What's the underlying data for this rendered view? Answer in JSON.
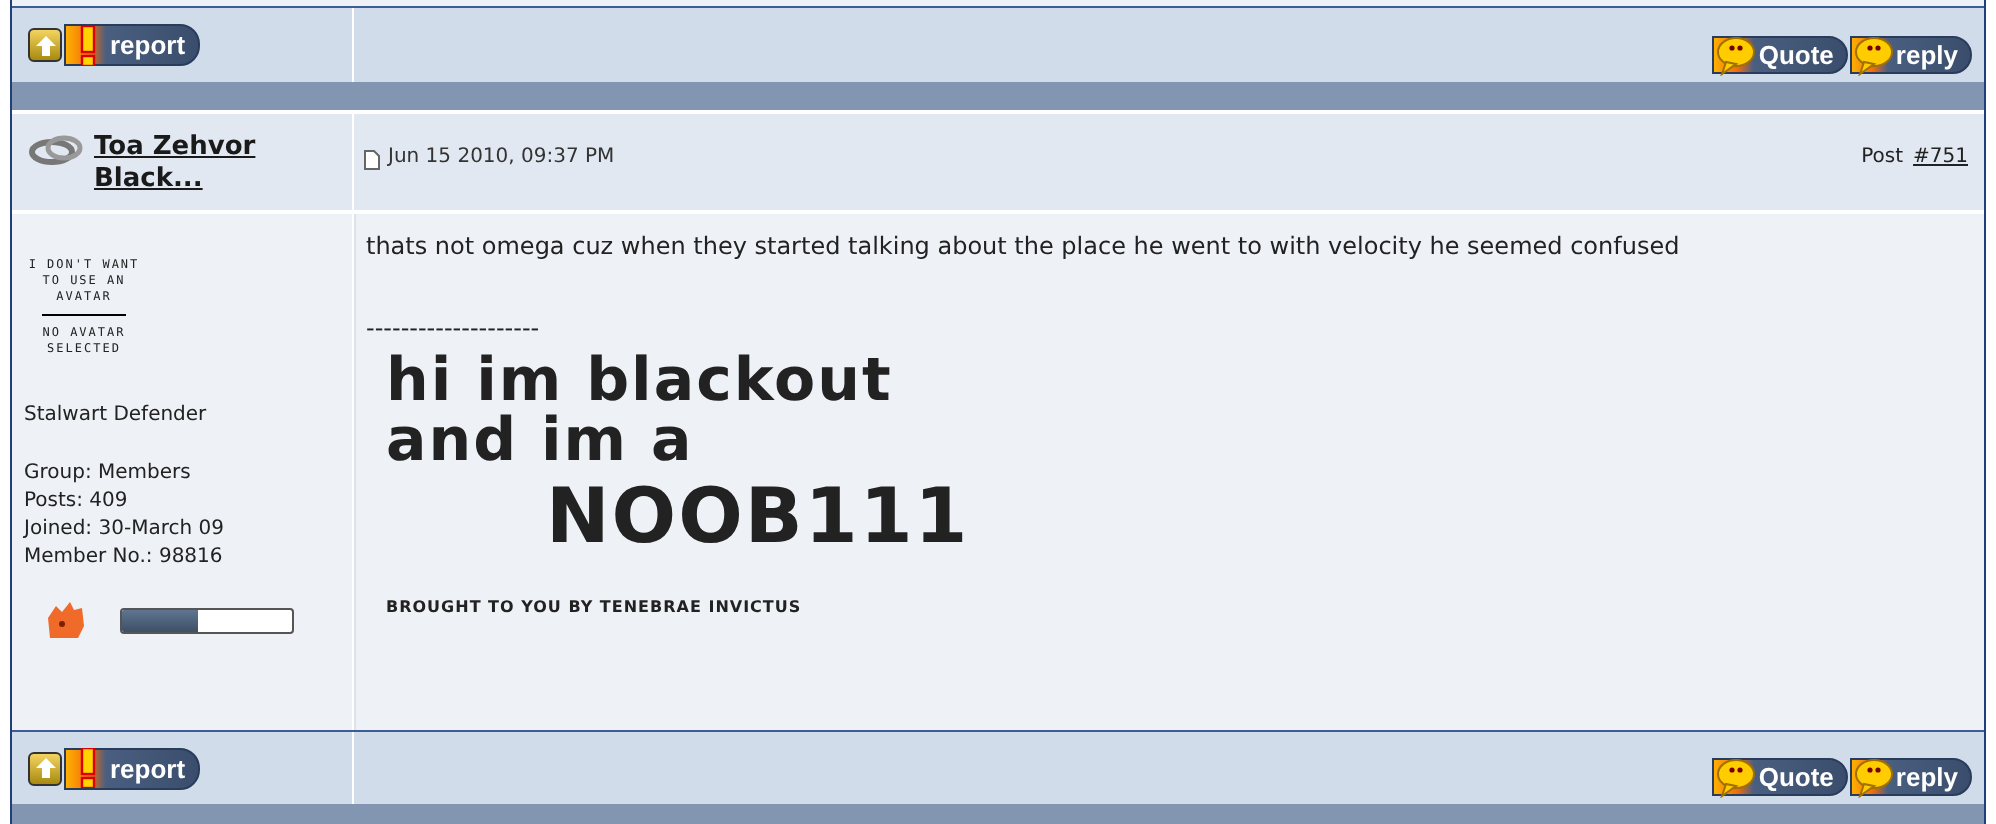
{
  "top_bar": {
    "buttons": [
      {
        "kind": "top"
      },
      {
        "kind": "report",
        "label": "report"
      },
      {
        "kind": "quote",
        "label": "Quote"
      },
      {
        "kind": "reply",
        "label": "reply"
      }
    ]
  },
  "post": {
    "author": "Toa Zehvor Black...",
    "date": "Jun 15 2010, 09:37 PM",
    "post_label": "Post",
    "post_number": "#751",
    "avatar": {
      "lines": [
        "I DON'T WANT",
        "TO USE AN",
        "AVATAR"
      ],
      "caption": [
        "NO AVATAR",
        "SELECTED"
      ]
    },
    "rank": "Stalwart Defender",
    "details": [
      {
        "label": "Group:",
        "value": "Members"
      },
      {
        "label": "Posts:",
        "value": "409"
      },
      {
        "label": "Joined:",
        "value": "30-March 09"
      },
      {
        "label": "Member No.:",
        "value": "98816"
      }
    ],
    "rank_meter": {
      "level": 0.45
    },
    "body": "thats not omega cuz when they started talking about the place he went to with velocity he seemed confused",
    "signature": {
      "separator": "--------------------",
      "scrawl": [
        "hi im blackout",
        "and im a",
        "NOOB111"
      ],
      "credit": "BROUGHT TO YOU BY TENEBRAE INVICTUS"
    }
  },
  "bottom_bar": {
    "buttons": [
      {
        "kind": "top"
      },
      {
        "kind": "report",
        "label": "report"
      },
      {
        "kind": "quote",
        "label": "Quote"
      },
      {
        "kind": "reply",
        "label": "reply"
      }
    ]
  }
}
